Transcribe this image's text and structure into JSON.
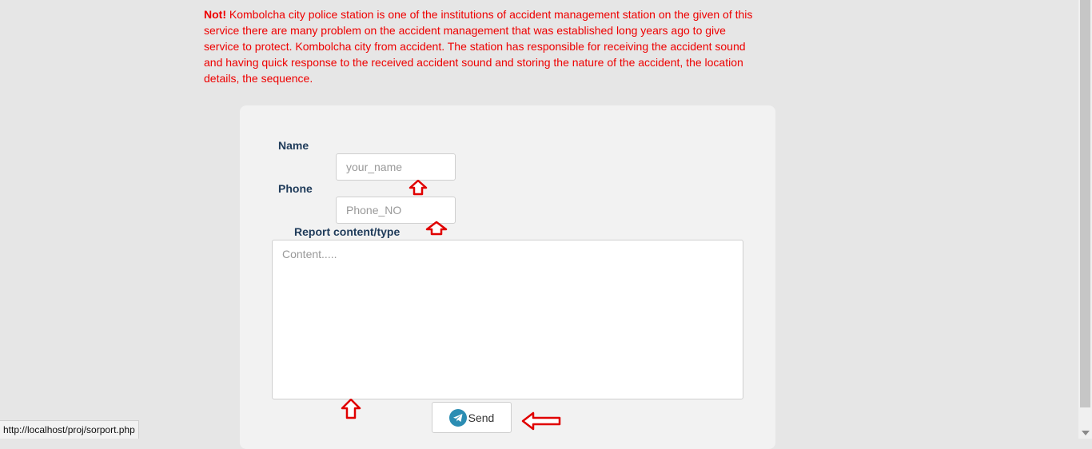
{
  "notice": {
    "prefix": "Not!",
    "text": " Kombolcha city police station is one of the institutions of accident management station on the given of this service there are many problem on the accident management that was established long years ago to give service to protect. Kombolcha city from accident. The station has responsible for receiving the accident sound and having quick response to the received accident sound and storing the nature of the accident, the location details, the sequence."
  },
  "form": {
    "name_label": "Name",
    "name_placeholder": "your_name",
    "phone_label": "Phone",
    "phone_placeholder": "Phone_NO",
    "content_label": "Report content/type",
    "content_placeholder": "Content.....",
    "send_label": "Send",
    "send_icon": "telegram-send-icon"
  },
  "colors": {
    "notice": "#ee0000",
    "label": "#1f3b5a",
    "annotation_arrow": "#e00000",
    "send_icon_bg": "#2b8db3"
  },
  "status_bar": {
    "url": "http://localhost/proj/sorport.php"
  }
}
